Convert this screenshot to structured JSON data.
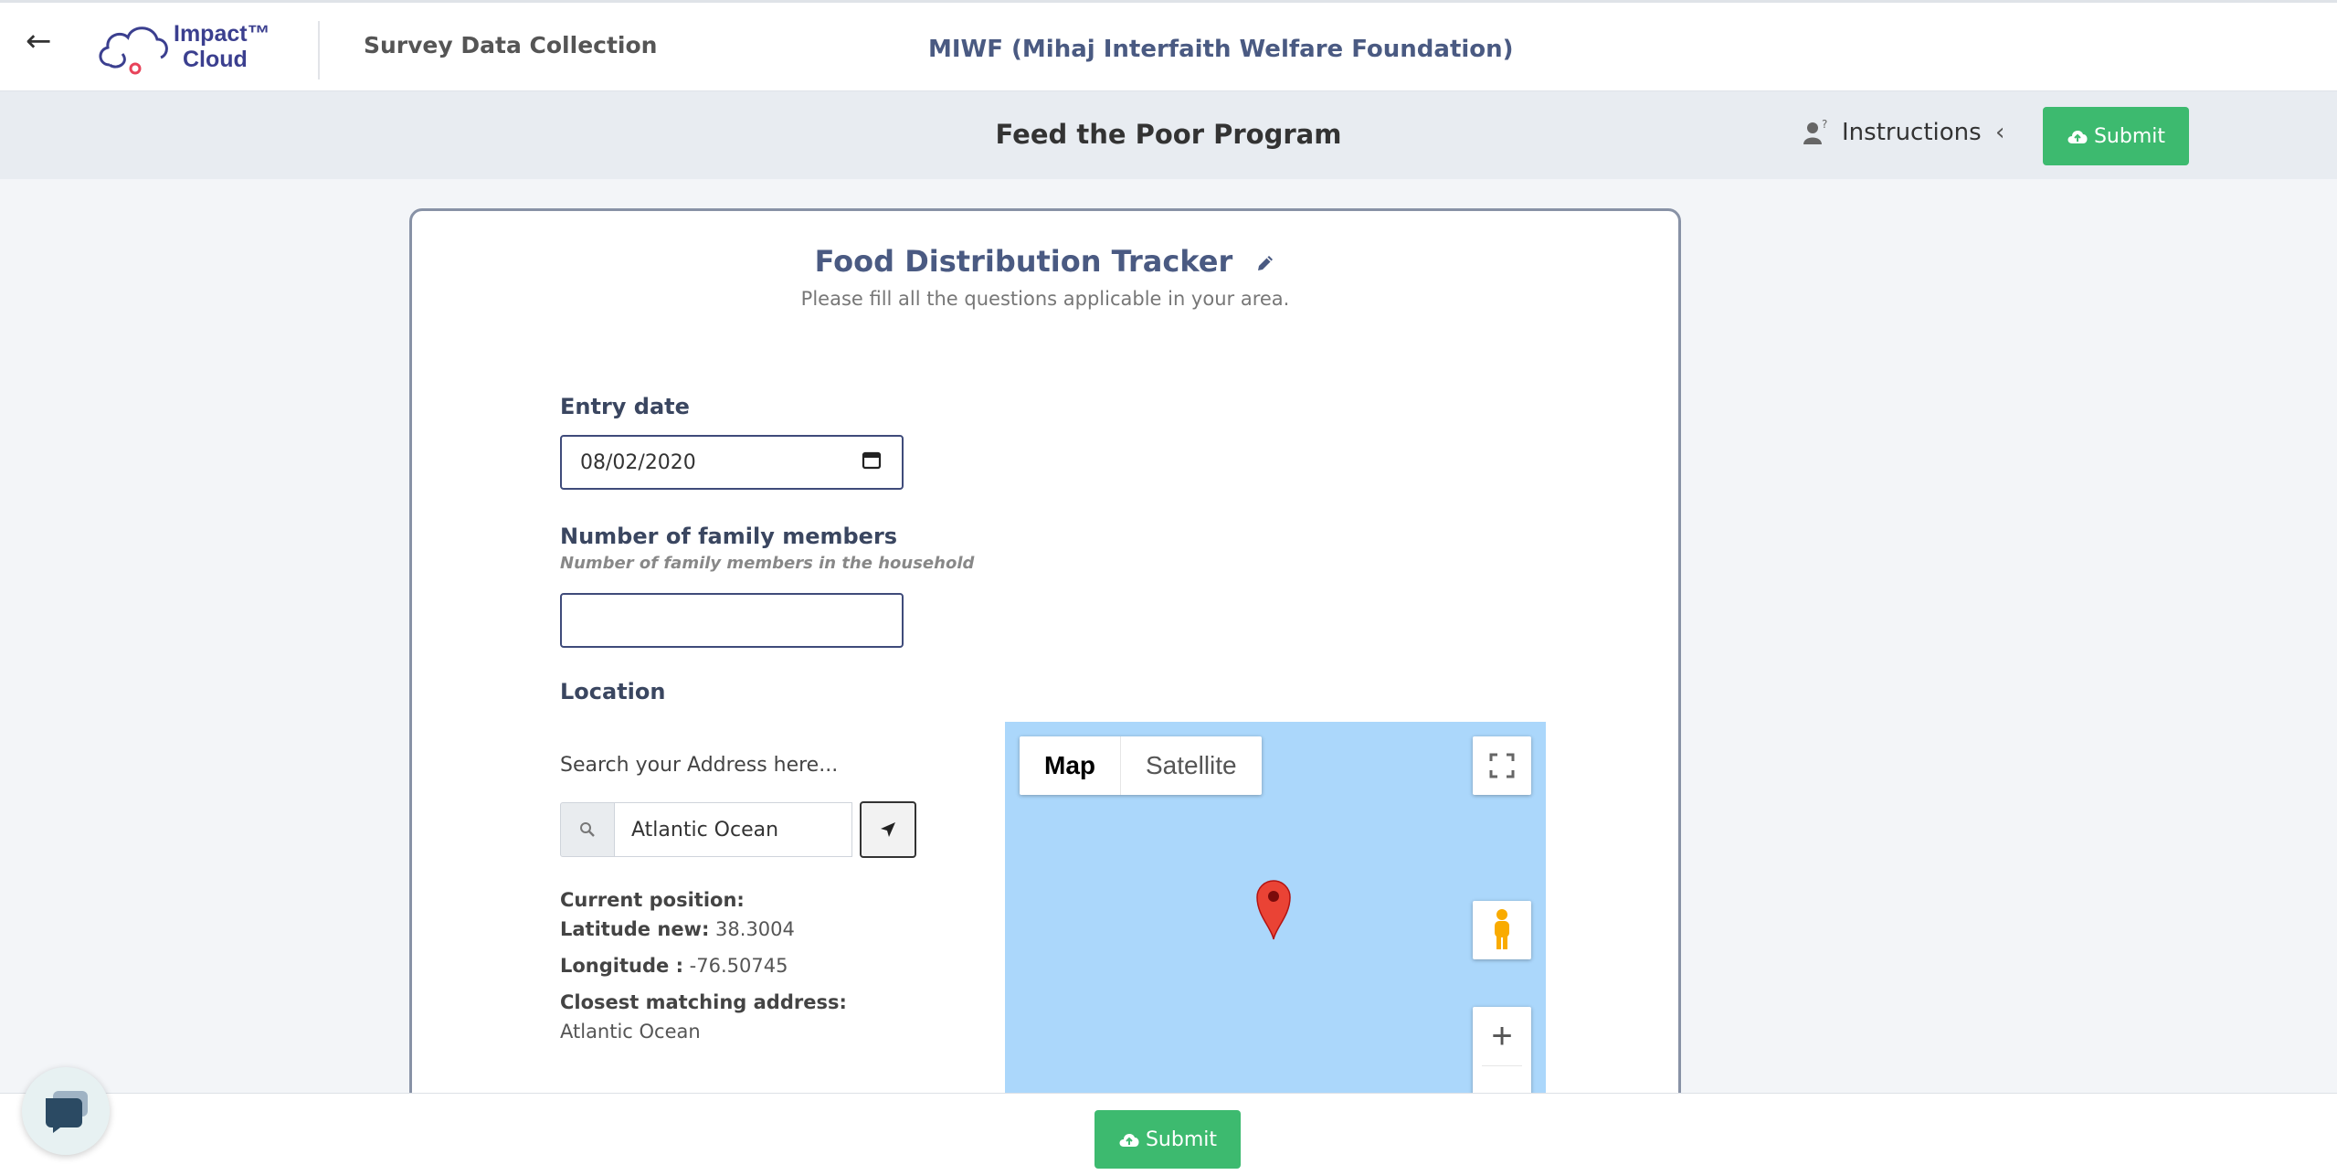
{
  "header": {
    "back_icon": "arrow-left-icon",
    "logo_line1": "Impact™",
    "logo_line2": "Cloud",
    "app_name": "Survey Data Collection",
    "org_name": "MIWF (Mihaj Interfaith Welfare Foundation)"
  },
  "subheader": {
    "program_title": "Feed the Poor Program",
    "instructions_label": "Instructions",
    "submit_label": "Submit"
  },
  "form": {
    "title": "Food Distribution Tracker",
    "subtitle": "Please fill all the questions applicable in your area.",
    "entry_date": {
      "label": "Entry date",
      "value": "08/02/2020"
    },
    "family_members": {
      "label": "Number of family members",
      "hint": "Number of family members in the household",
      "value": ""
    },
    "location": {
      "label": "Location",
      "search_label": "Search your Address here...",
      "search_value": "Atlantic Ocean",
      "current_position_label": "Current position:",
      "latitude_label": "Latitude new:",
      "latitude_value": "38.3004",
      "longitude_label": "Longitude :",
      "longitude_value": "-76.50745",
      "closest_label": "Closest matching address:",
      "closest_value": "Atlantic Ocean"
    }
  },
  "map": {
    "type_map": "Map",
    "type_satellite": "Satellite",
    "zoom_in": "+",
    "water_color": "#abd7fb",
    "pin_color": "#ea4335"
  },
  "footer": {
    "submit_label": "Submit"
  },
  "colors": {
    "accent_green": "#3dba6f",
    "title_blue": "#4a5a82",
    "subheader_bg": "#e8ecf1"
  }
}
